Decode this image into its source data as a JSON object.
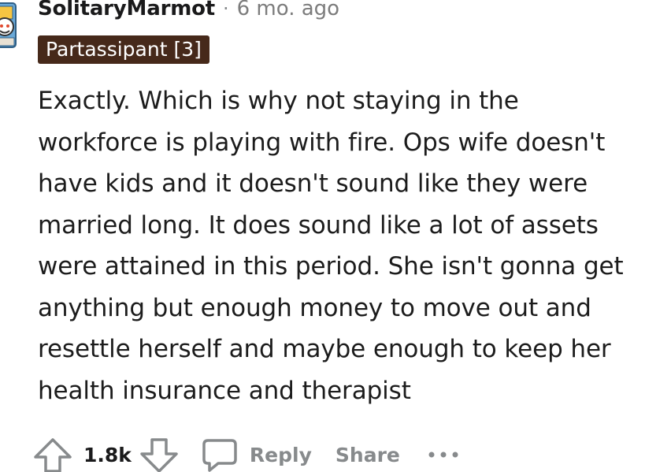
{
  "comment": {
    "author": "SolitaryMarmot",
    "separator": "·",
    "timestamp": "6 mo. ago",
    "flair": "Partassipant [3]",
    "body": "Exactly. Which is why not staying in the\nworkforce is playing with fire. Ops wife doesn't\nhave kids and it doesn't sound like they were\nmarried long. It does sound like a lot of assets\nwere attained in this period. She isn't gonna get\nanything but enough money to move out and\nresettle herself and maybe enough to keep her\nhealth insurance and therapist"
  },
  "actions": {
    "upvote_icon": "arrow-up-icon",
    "vote_count": "1.8k",
    "downvote_icon": "arrow-down-icon",
    "reply_icon": "speech-bubble-icon",
    "reply_label": "Reply",
    "share_label": "Share",
    "more_icon": "ellipsis-icon"
  },
  "colors": {
    "flair_background": "#46291a",
    "flair_text": "#ffffff",
    "muted_text": "#878a8c",
    "primary_text": "#1a1a1b"
  }
}
